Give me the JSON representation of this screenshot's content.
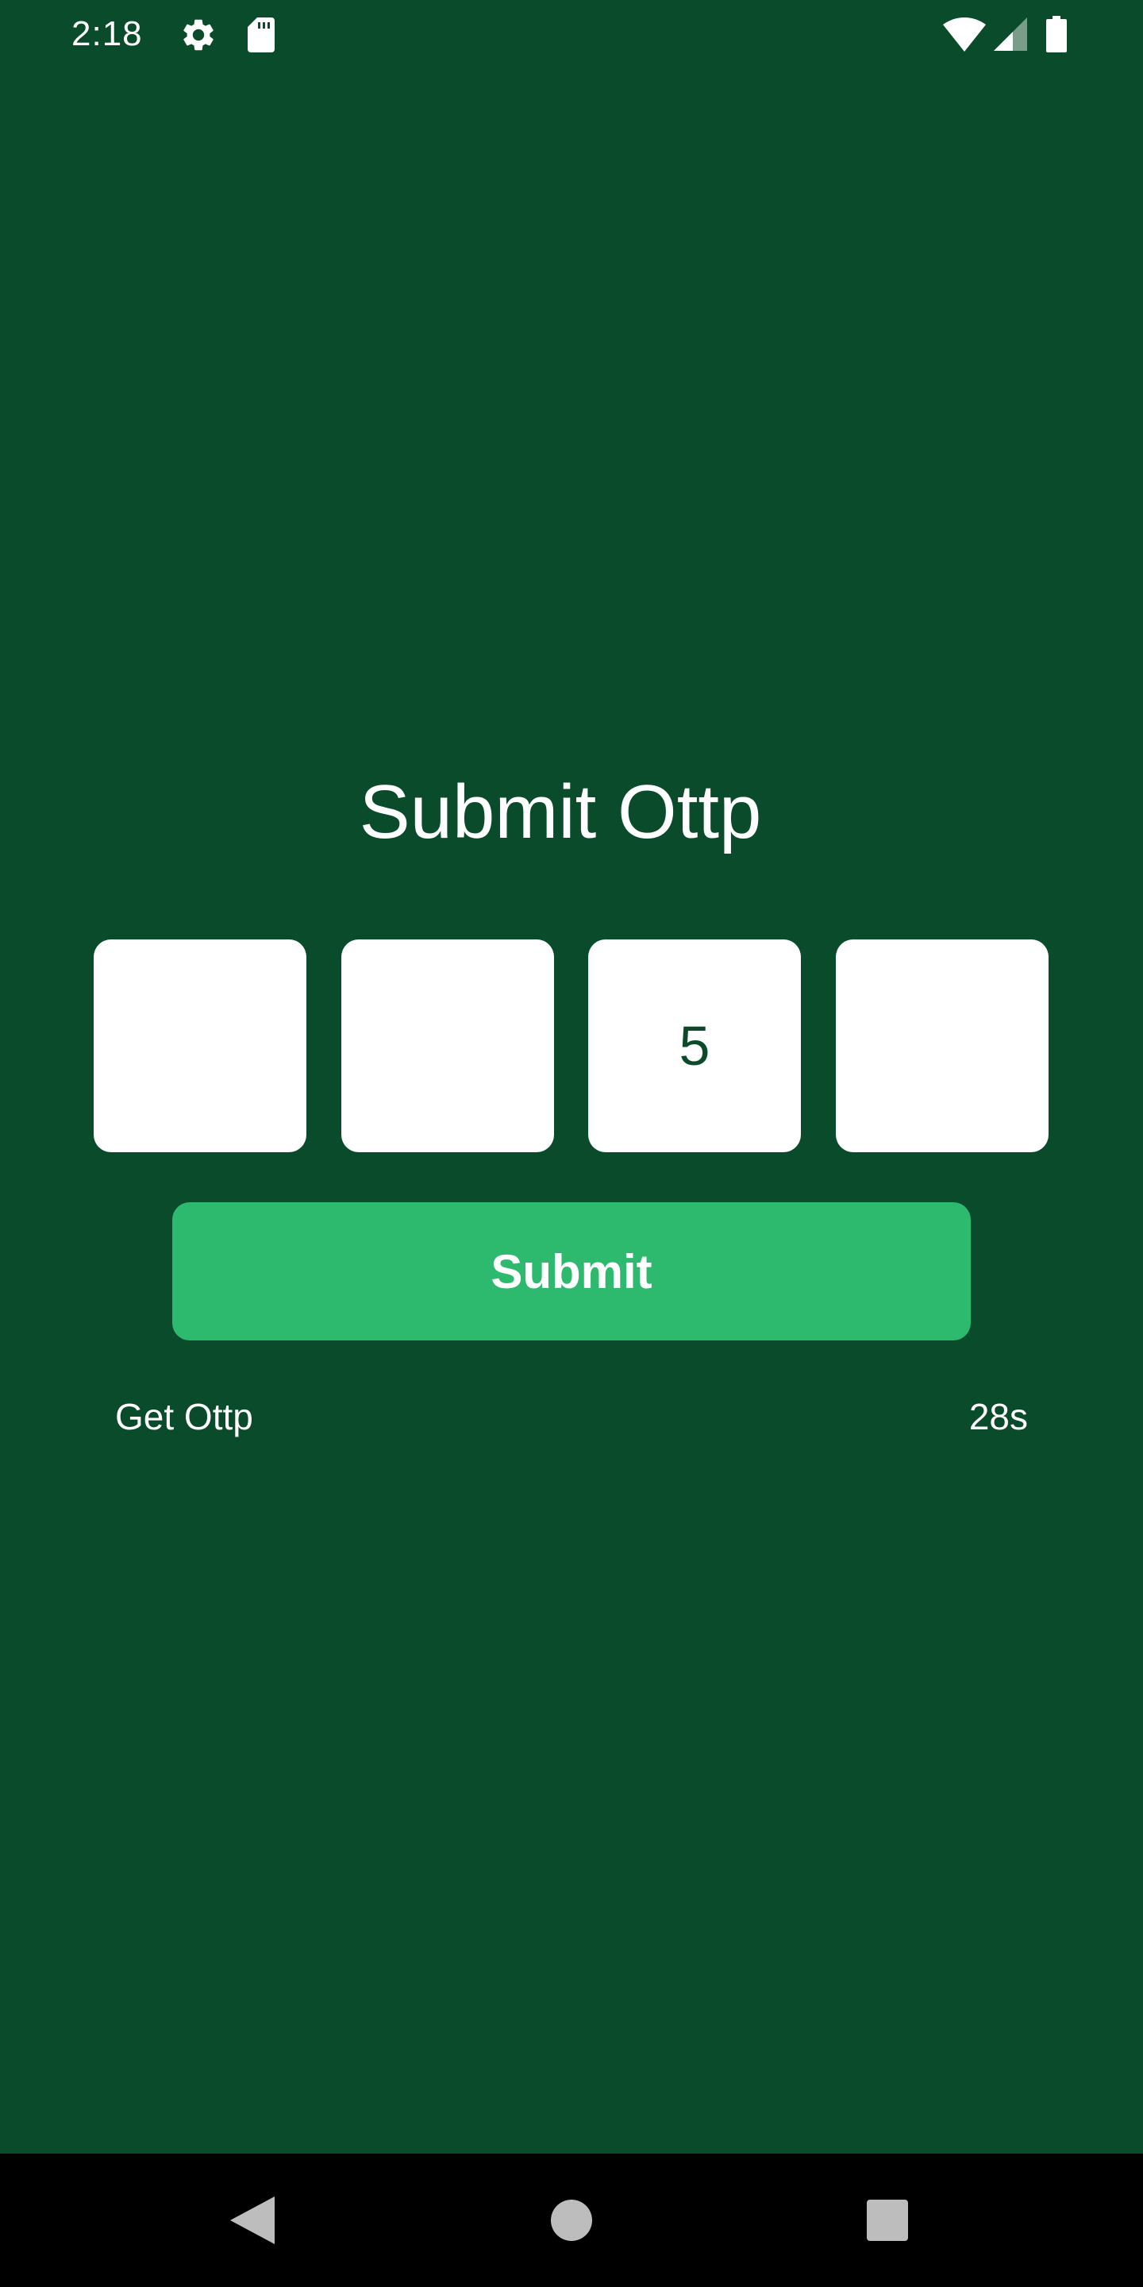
{
  "status_bar": {
    "time": "2:18",
    "icons": [
      "gear-icon",
      "sd-card-icon",
      "wifi-icon",
      "signal-icon",
      "battery-icon"
    ]
  },
  "page": {
    "title": "Submit Ottp"
  },
  "otp": {
    "digits": [
      "",
      "",
      "5",
      ""
    ]
  },
  "actions": {
    "submit_label": "Submit",
    "get_otp_label": "Get Ottp",
    "timer": "28s"
  },
  "nav_bar": {
    "buttons": [
      "back-icon",
      "home-icon",
      "recents-icon"
    ]
  },
  "colors": {
    "background": "#094b2a",
    "accent": "#2dba6e",
    "box": "#ffffff",
    "digit": "#0b4a2a"
  }
}
